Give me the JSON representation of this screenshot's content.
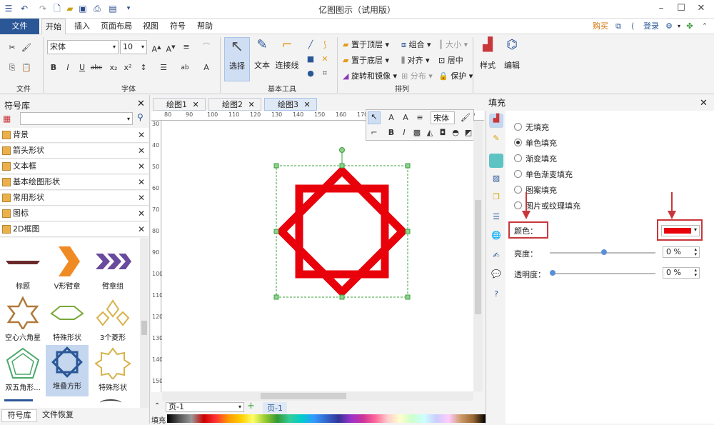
{
  "window": {
    "title": "亿图图示（试用版）"
  },
  "menu": {
    "file": "文件",
    "tabs": [
      "开始",
      "插入",
      "页面布局",
      "视图",
      "符号",
      "帮助"
    ],
    "buy": "购买",
    "login": "登录"
  },
  "ribbon": {
    "font_name": "宋体",
    "font_size": "10",
    "groups": {
      "file": "文件",
      "font": "字体",
      "basic_tools": "基本工具",
      "arrange": "排列"
    },
    "tools": {
      "select": "选择",
      "text": "文本",
      "connector": "连接线"
    },
    "arrange": {
      "bring_front": "置于顶层",
      "send_back": "置于底层",
      "rotate": "旋转和镜像",
      "group": "组合",
      "align": "对齐",
      "distribute": "分布",
      "size": "大小",
      "center": "居中",
      "protect": "保护"
    },
    "style": "样式",
    "edit": "编辑"
  },
  "library": {
    "title": "符号库",
    "search_placeholder": "",
    "categories": [
      "背景",
      "箭头形状",
      "文本框",
      "基本绘图形状",
      "常用形状",
      "图标",
      "2D框图"
    ],
    "shapes": [
      {
        "label": "标题"
      },
      {
        "label": "V形臂章"
      },
      {
        "label": "臂章组"
      },
      {
        "label": "空心六角星"
      },
      {
        "label": "特殊形状"
      },
      {
        "label": "3个菱形"
      },
      {
        "label": "双五角形..."
      },
      {
        "label": "堆叠方形"
      },
      {
        "label": "特殊形状"
      }
    ],
    "bottom_tabs": [
      "符号库",
      "文件恢复"
    ]
  },
  "tabs": [
    "绘图1",
    "绘图2",
    "绘图3"
  ],
  "ruler": {
    "h": [
      "80",
      "90",
      "100",
      "110",
      "120",
      "130",
      "140",
      "150",
      "160",
      "170",
      "180",
      "190",
      "200",
      "210",
      "220",
      "230"
    ],
    "v": [
      "30",
      "40",
      "50",
      "60",
      "70",
      "80",
      "90",
      "100",
      "110",
      "120",
      "130",
      "140",
      "150"
    ]
  },
  "float_toolbar": {
    "font": "宋体"
  },
  "status": {
    "page_select": "页-1",
    "page_tab": "页-1",
    "fill_label": "填充"
  },
  "fill_panel": {
    "title": "填充",
    "options": [
      "无填充",
      "单色填充",
      "渐变填充",
      "单色渐变填充",
      "图案填充",
      "图片或纹理填充"
    ],
    "selected": "单色填充",
    "color_label": "颜色：",
    "color_value": "#e8000b",
    "brightness_label": "亮度：",
    "brightness": "0 %",
    "transparency_label": "透明度：",
    "transparency": "0 %"
  },
  "colors": {
    "accent": "#2b5797",
    "shape_red": "#e8000b",
    "highlight": "#c9373b",
    "selection": "#3aa13a"
  }
}
